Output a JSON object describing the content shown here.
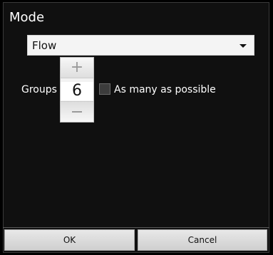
{
  "dialog": {
    "title": "Mode",
    "mode_select": {
      "value": "Flow"
    },
    "groups": {
      "label": "Groups",
      "stepper_value": "6",
      "plus_symbol": "+",
      "as_many_as_possible_label": "As many as possible",
      "as_many_as_possible_checked": false
    },
    "buttons": {
      "ok_label": "OK",
      "cancel_label": "Cancel"
    }
  },
  "colors": {
    "background": "#000000",
    "dialog_bg": "#101010",
    "text": "#ffffff",
    "control_bg": "#f4f4f4"
  },
  "icons": {
    "select_arrow": "chevron-down-icon",
    "increment": "plus-icon",
    "decrement": "minus-icon"
  }
}
